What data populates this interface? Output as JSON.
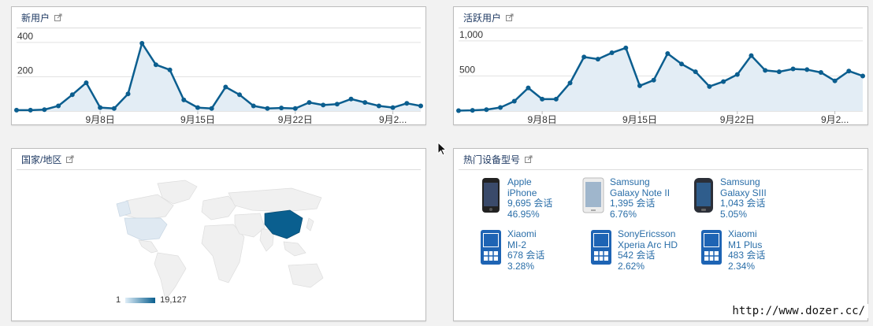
{
  "panels": {
    "new_users": {
      "title": "新用户",
      "chart_data": {
        "type": "area",
        "title": "新用户",
        "x": [
          1,
          2,
          3,
          4,
          5,
          6,
          7,
          8,
          9,
          10,
          11,
          12,
          13,
          14,
          15,
          16,
          17,
          18,
          19,
          20,
          21,
          22,
          23,
          24,
          25,
          26,
          27,
          28,
          29,
          30
        ],
        "values": [
          5,
          5,
          8,
          30,
          95,
          165,
          20,
          15,
          100,
          395,
          270,
          240,
          65,
          20,
          15,
          140,
          95,
          30,
          15,
          18,
          15,
          50,
          35,
          40,
          70,
          50,
          30,
          20,
          45,
          30
        ],
        "ylim": [
          0,
          450
        ],
        "yticks": [
          200,
          400
        ],
        "xticks": [
          {
            "x": 7,
            "label": "9月8日"
          },
          {
            "x": 14,
            "label": "9月15日"
          },
          {
            "x": 21,
            "label": "9月22日"
          },
          {
            "x": 28,
            "label": "9月2..."
          }
        ],
        "grid": true,
        "color": "#0b5e8f",
        "fill": "#e3edf5"
      }
    },
    "active_users": {
      "title": "活跃用户",
      "chart_data": {
        "type": "area",
        "title": "活跃用户",
        "x": [
          1,
          2,
          3,
          4,
          5,
          6,
          7,
          8,
          9,
          10,
          11,
          12,
          13,
          14,
          15,
          16,
          17,
          18,
          19,
          20,
          21,
          22,
          23,
          24,
          25,
          26,
          27,
          28,
          29,
          30
        ],
        "values": [
          5,
          10,
          20,
          50,
          140,
          330,
          170,
          170,
          400,
          770,
          740,
          830,
          900,
          360,
          440,
          820,
          670,
          560,
          350,
          420,
          520,
          790,
          580,
          560,
          600,
          590,
          550,
          430,
          570,
          500
        ],
        "ylim": [
          0,
          1100
        ],
        "yticks": [
          500,
          1000
        ],
        "ytick_labels": [
          "500",
          "1,000"
        ],
        "xticks": [
          {
            "x": 7,
            "label": "9月8日"
          },
          {
            "x": 14,
            "label": "9月15日"
          },
          {
            "x": 21,
            "label": "9月22日"
          },
          {
            "x": 28,
            "label": "9月2..."
          }
        ],
        "grid": true,
        "color": "#0b5e8f",
        "fill": "#e3edf5"
      }
    },
    "country": {
      "title": "国家/地区",
      "legend_min": "1",
      "legend_max": "19,127",
      "highlight_color": "#0a5f8f",
      "light_color": "#dfe9f2",
      "base_color": "#f0f0f0"
    },
    "devices": {
      "title": "热门设备型号",
      "items": [
        {
          "brand": "Apple",
          "model": "iPhone",
          "sessions": "9,695 会话",
          "percent": "46.95%",
          "icon": "iphone-image"
        },
        {
          "brand": "Samsung",
          "model": "Galaxy Note II",
          "sessions": "1,395 会话",
          "percent": "6.76%",
          "icon": "galaxy-note-image"
        },
        {
          "brand": "Samsung",
          "model": "Galaxy SIII",
          "sessions": "1,043 会话",
          "percent": "5.05%",
          "icon": "galaxy-s3-image"
        },
        {
          "brand": "Xiaomi",
          "model": "MI-2",
          "sessions": "678 会话",
          "percent": "3.28%",
          "icon": "generic-phone-icon"
        },
        {
          "brand": "SonyEricsson",
          "model": "Xperia Arc HD",
          "sessions": "542 会话",
          "percent": "2.62%",
          "icon": "generic-phone-icon"
        },
        {
          "brand": "Xiaomi",
          "model": "M1 Plus",
          "sessions": "483 会话",
          "percent": "2.34%",
          "icon": "generic-phone-icon"
        }
      ]
    }
  },
  "watermark": "http://www.dozer.cc/"
}
